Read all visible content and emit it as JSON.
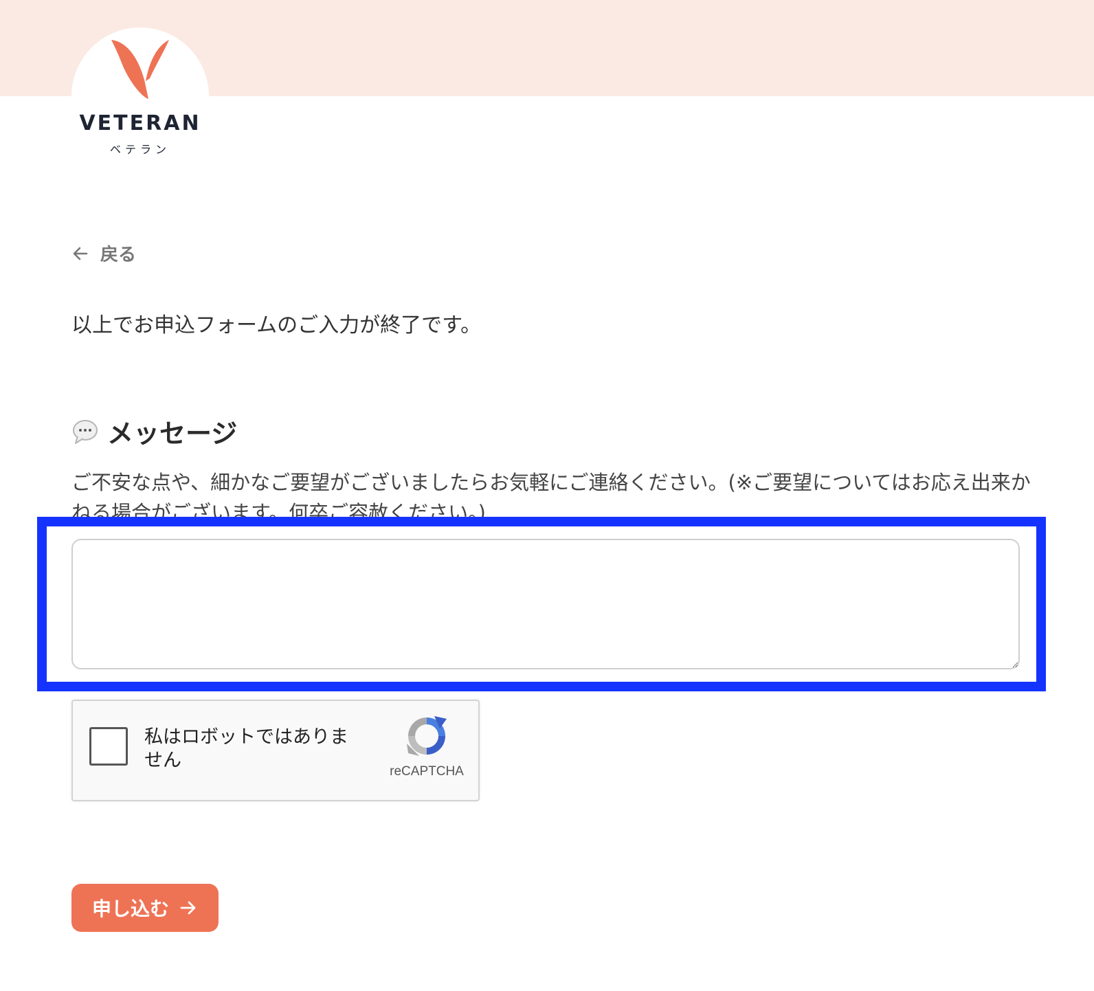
{
  "brand": {
    "name": "VETERAN",
    "kana": "ベテラン",
    "accent_color": "#ee7355",
    "header_band_color": "#fbeae3"
  },
  "nav": {
    "back_label": "戻る",
    "back_icon": "arrow-left-icon"
  },
  "form": {
    "lead_text": "以上でお申込フォームのご入力が終了です。",
    "message_section": {
      "icon": "speech-bubble-icon",
      "title": "メッセージ",
      "description": "ご不安な点や、細かなご要望がございましたらお気軽にご連絡ください。(※ご要望についてはお応え出来かねる場合がございます。何卒ご容赦ください。)",
      "textarea_value": "",
      "highlight_color": "#1533ff"
    },
    "recaptcha": {
      "label": "私はロボットではありません",
      "brand": "reCAPTCHA"
    },
    "submit": {
      "label": "申し込む",
      "icon": "arrow-right-icon"
    }
  }
}
